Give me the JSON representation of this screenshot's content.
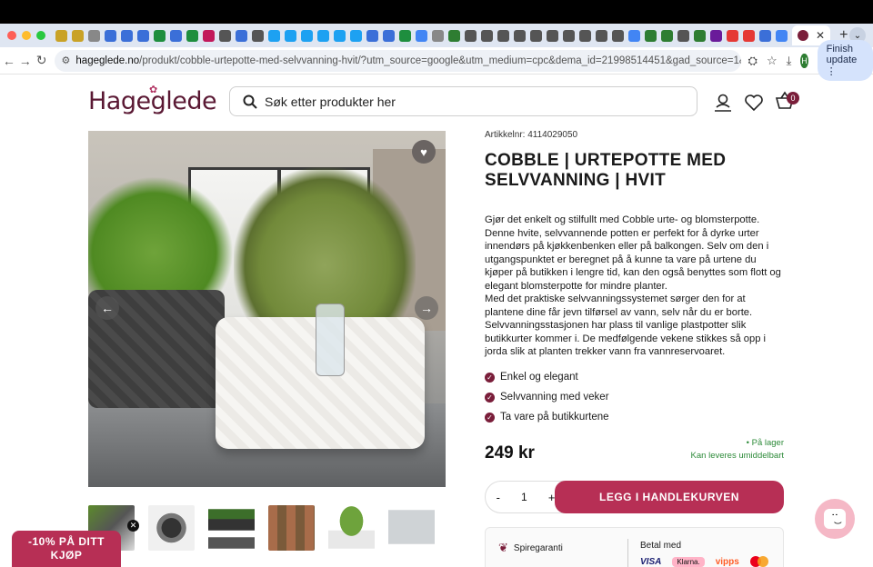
{
  "browser": {
    "url_domain": "hageglede.no",
    "url_path": "/produkt/cobble-urtepotte-med-selvvanning-hvit/?utm_source=google&utm_medium=cpc&dema_id=21998514451&gad_source=1&gad_c...",
    "profile_initial": "H",
    "finish_update_label": "Finish update"
  },
  "site": {
    "logo_text": "Hageglede",
    "search_placeholder": "Søk etter produkter her",
    "cart_count": "0"
  },
  "product": {
    "sku_label": "Artikkelnr: 4114029050",
    "title": "COBBLE | URTEPOTTE MED SELVVANNING | HVIT",
    "description_1": "Gjør det enkelt og stilfullt med Cobble urte- og blomsterpotte. Denne hvite, selvvannende potten er perfekt for å dyrke urter innendørs på kjøkkenbenken eller på balkongen. Selv om den i utgangspunktet er beregnet på å kunne ta vare på urtene du kjøper på butikken i lengre tid, kan den også benyttes som flott og elegant blomsterpotte for mindre planter.",
    "description_2": "Med det praktiske selvvanningssystemet sørger den for at plantene dine får jevn tilførsel av vann, selv når du er borte. Selvvanningsstasjonen har plass til vanlige plastpotter slik butikkurter kommer i. De medfølgende vekene stikkes så opp i jorda slik at planten trekker vann fra vannreservoaret.",
    "features": [
      "Enkel og elegant",
      "Selvvanning med veker",
      "Ta vare på butikkurtene"
    ],
    "stock_status": "• På lager",
    "delivery": "Kan leveres umiddelbart",
    "price": "249 kr",
    "quantity": "1",
    "add_to_cart_label": "LEGG I HANDLEKURVEN"
  },
  "info": {
    "guarantee_label": "Spiregaranti",
    "pay_heading": "Betal med",
    "pay_methods": [
      "VISA",
      "Klarna.",
      "vipps"
    ]
  },
  "promo": {
    "discount_line1": "-10% PÅ DITT",
    "discount_line2": "KJØP"
  },
  "colors": {
    "brand": "#7a1e3a",
    "accent": "#b72f55",
    "stock": "#2e8b3a"
  }
}
